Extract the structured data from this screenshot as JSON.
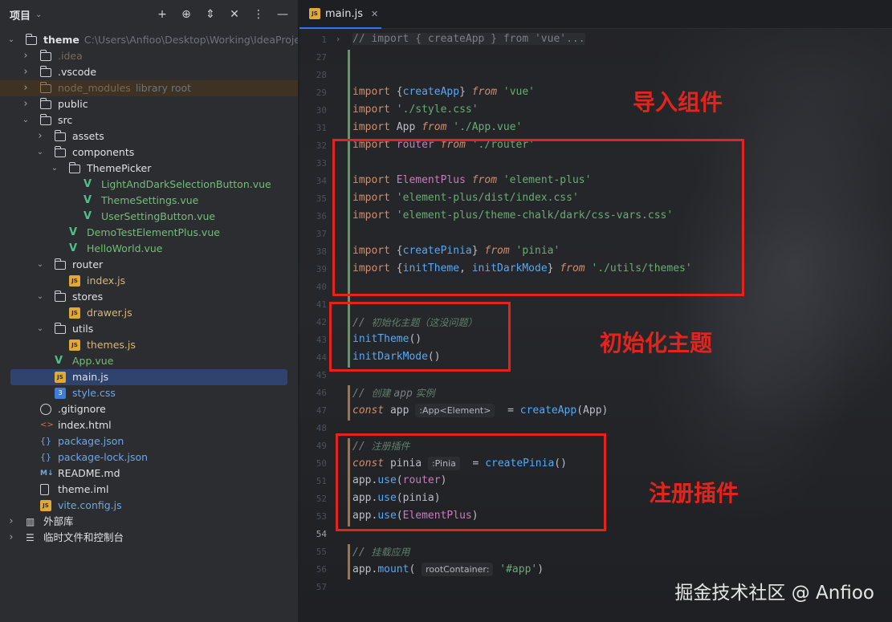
{
  "panel": {
    "title": "项目",
    "tools": [
      "add-icon",
      "locate-icon",
      "expand-icon",
      "collapse-icon",
      "more-icon",
      "minimize-icon"
    ]
  },
  "tree": [
    {
      "depth": 0,
      "arrow": "open",
      "icon": "folder",
      "label": "theme",
      "path": "C:\\Users\\Anfioo\\Desktop\\Working\\IdeaProjects\\",
      "bold": true,
      "color": "normal"
    },
    {
      "depth": 1,
      "arrow": "closed",
      "icon": "folder",
      "label": ".idea",
      "color": "excluded"
    },
    {
      "depth": 1,
      "arrow": "closed",
      "icon": "folder",
      "label": ".vscode",
      "color": "normal"
    },
    {
      "depth": 1,
      "arrow": "closed",
      "icon": "folder-excl",
      "label": "node_modules",
      "tag": "library root",
      "color": "excluded",
      "libroot": true
    },
    {
      "depth": 1,
      "arrow": "closed",
      "icon": "folder",
      "label": "public",
      "color": "normal"
    },
    {
      "depth": 1,
      "arrow": "open",
      "icon": "folder",
      "label": "src",
      "color": "normal"
    },
    {
      "depth": 2,
      "arrow": "closed",
      "icon": "folder",
      "label": "assets",
      "color": "normal"
    },
    {
      "depth": 2,
      "arrow": "open",
      "icon": "folder",
      "label": "components",
      "color": "normal"
    },
    {
      "depth": 3,
      "arrow": "open",
      "icon": "folder",
      "label": "ThemePicker",
      "color": "normal"
    },
    {
      "depth": 4,
      "arrow": "",
      "icon": "vue",
      "label": "LightAndDarkSelectionButton.vue",
      "color": "green"
    },
    {
      "depth": 4,
      "arrow": "",
      "icon": "vue",
      "label": "ThemeSettings.vue",
      "color": "green"
    },
    {
      "depth": 4,
      "arrow": "",
      "icon": "vue",
      "label": "UserSettingButton.vue",
      "color": "green"
    },
    {
      "depth": 3,
      "arrow": "",
      "icon": "vue",
      "label": "DemoTestElementPlus.vue",
      "color": "green"
    },
    {
      "depth": 3,
      "arrow": "",
      "icon": "vue",
      "label": "HelloWorld.vue",
      "color": "green"
    },
    {
      "depth": 2,
      "arrow": "open",
      "icon": "folder",
      "label": "router",
      "color": "normal"
    },
    {
      "depth": 3,
      "arrow": "",
      "icon": "js",
      "label": "index.js",
      "color": "yellow"
    },
    {
      "depth": 2,
      "arrow": "open",
      "icon": "folder",
      "label": "stores",
      "color": "normal"
    },
    {
      "depth": 3,
      "arrow": "",
      "icon": "js",
      "label": "drawer.js",
      "color": "yellow"
    },
    {
      "depth": 2,
      "arrow": "open",
      "icon": "folder",
      "label": "utils",
      "color": "normal"
    },
    {
      "depth": 3,
      "arrow": "",
      "icon": "js",
      "label": "themes.js",
      "color": "yellow"
    },
    {
      "depth": 2,
      "arrow": "",
      "icon": "vue",
      "label": "App.vue",
      "color": "green"
    },
    {
      "depth": 2,
      "arrow": "",
      "icon": "js",
      "label": "main.js",
      "color": "normal",
      "selected": true
    },
    {
      "depth": 2,
      "arrow": "",
      "icon": "css",
      "label": "style.css",
      "color": "blue"
    },
    {
      "depth": 1,
      "arrow": "",
      "icon": "git",
      "label": ".gitignore",
      "color": "normal"
    },
    {
      "depth": 1,
      "arrow": "",
      "icon": "html",
      "label": "index.html",
      "color": "normal"
    },
    {
      "depth": 1,
      "arrow": "",
      "icon": "json",
      "label": "package.json",
      "color": "blue"
    },
    {
      "depth": 1,
      "arrow": "",
      "icon": "json",
      "label": "package-lock.json",
      "color": "blue"
    },
    {
      "depth": 1,
      "arrow": "",
      "icon": "md",
      "label": "README.md",
      "color": "normal"
    },
    {
      "depth": 1,
      "arrow": "",
      "icon": "file",
      "label": "theme.iml",
      "color": "normal"
    },
    {
      "depth": 1,
      "arrow": "",
      "icon": "js",
      "label": "vite.config.js",
      "color": "blue"
    },
    {
      "depth": 0,
      "arrow": "closed",
      "icon": "lib",
      "label": "外部库",
      "color": "normal"
    },
    {
      "depth": 0,
      "arrow": "closed",
      "icon": "scratch",
      "label": "临时文件和控制台",
      "color": "normal"
    }
  ],
  "editor": {
    "tab_label": "main.js",
    "lines": [
      {
        "n": "1",
        "parts": [
          [
            "folded",
            "// import { createApp } from 'vue'..."
          ]
        ],
        "fold": true
      },
      {
        "n": "27",
        "parts": []
      },
      {
        "n": "28",
        "parts": []
      },
      {
        "n": "29",
        "parts": [
          [
            "kw-imp",
            "import"
          ],
          [
            "",
            " {"
          ],
          [
            "fn",
            "createApp"
          ],
          [
            "",
            "} "
          ],
          [
            "kw",
            "from"
          ],
          [
            "",
            " "
          ],
          [
            "str",
            "'vue'"
          ]
        ]
      },
      {
        "n": "30",
        "parts": [
          [
            "kw-imp",
            "import"
          ],
          [
            "",
            " "
          ],
          [
            "str",
            "'./style.css'"
          ]
        ]
      },
      {
        "n": "31",
        "parts": [
          [
            "kw-imp",
            "import"
          ],
          [
            "",
            " App "
          ],
          [
            "kw",
            "from"
          ],
          [
            "",
            " "
          ],
          [
            "str",
            "'./App.vue'"
          ]
        ]
      },
      {
        "n": "32",
        "parts": [
          [
            "kw-imp",
            "import"
          ],
          [
            "",
            " "
          ],
          [
            "var",
            "router"
          ],
          [
            "",
            " "
          ],
          [
            "kw",
            "from"
          ],
          [
            "",
            " "
          ],
          [
            "str",
            "'./router'"
          ]
        ]
      },
      {
        "n": "33",
        "parts": []
      },
      {
        "n": "34",
        "parts": [
          [
            "kw-imp",
            "import"
          ],
          [
            "",
            " "
          ],
          [
            "var",
            "ElementPlus"
          ],
          [
            "",
            " "
          ],
          [
            "kw",
            "from"
          ],
          [
            "",
            " "
          ],
          [
            "str",
            "'element-plus'"
          ]
        ]
      },
      {
        "n": "35",
        "parts": [
          [
            "kw-imp",
            "import"
          ],
          [
            "",
            " "
          ],
          [
            "str",
            "'element-plus/dist/index.css'"
          ]
        ]
      },
      {
        "n": "36",
        "parts": [
          [
            "kw-imp",
            "import"
          ],
          [
            "",
            " "
          ],
          [
            "str",
            "'element-plus/theme-chalk/dark/css-vars.css'"
          ]
        ]
      },
      {
        "n": "37",
        "parts": []
      },
      {
        "n": "38",
        "parts": [
          [
            "kw-imp",
            "import"
          ],
          [
            "",
            " {"
          ],
          [
            "fn",
            "createPinia"
          ],
          [
            "",
            "} "
          ],
          [
            "kw",
            "from"
          ],
          [
            "",
            " "
          ],
          [
            "str",
            "'pinia'"
          ]
        ]
      },
      {
        "n": "39",
        "parts": [
          [
            "kw-imp",
            "import"
          ],
          [
            "",
            " {"
          ],
          [
            "fn",
            "initTheme"
          ],
          [
            "",
            ", "
          ],
          [
            "fn",
            "initDarkMode"
          ],
          [
            "",
            "} "
          ],
          [
            "kw",
            "from"
          ],
          [
            "",
            " "
          ],
          [
            "str",
            "'./utils/themes'"
          ]
        ]
      },
      {
        "n": "40",
        "parts": []
      },
      {
        "n": "41",
        "parts": []
      },
      {
        "n": "42",
        "parts": [
          [
            "cmt",
            "// "
          ],
          [
            "cmt-zh",
            "初始化主题（这没问题）"
          ]
        ]
      },
      {
        "n": "43",
        "parts": [
          [
            "fn",
            "initTheme"
          ],
          [
            "",
            "()"
          ]
        ]
      },
      {
        "n": "44",
        "parts": [
          [
            "fn",
            "initDarkMode"
          ],
          [
            "",
            "()"
          ]
        ]
      },
      {
        "n": "45",
        "parts": []
      },
      {
        "n": "46",
        "parts": [
          [
            "cmt",
            "// "
          ],
          [
            "cmt-zh",
            "创建 "
          ],
          [
            "cmt",
            "app"
          ],
          [
            "cmt-zh",
            " 实例"
          ]
        ]
      },
      {
        "n": "47",
        "parts": [
          [
            "kw",
            "const"
          ],
          [
            "",
            " app "
          ],
          [
            "hint",
            ":App<Element>"
          ],
          [
            "",
            "  = "
          ],
          [
            "fn",
            "createApp"
          ],
          [
            "",
            "(App)"
          ]
        ]
      },
      {
        "n": "48",
        "parts": []
      },
      {
        "n": "49",
        "parts": [
          [
            "cmt",
            "// "
          ],
          [
            "cmt-zh",
            "注册插件"
          ]
        ]
      },
      {
        "n": "50",
        "parts": [
          [
            "kw",
            "const"
          ],
          [
            "",
            " pinia "
          ],
          [
            "hint",
            ":Pinia"
          ],
          [
            "",
            "  = "
          ],
          [
            "fn",
            "createPinia"
          ],
          [
            "",
            "()"
          ]
        ]
      },
      {
        "n": "51",
        "parts": [
          [
            "",
            "app."
          ],
          [
            "fn",
            "use"
          ],
          [
            "",
            "("
          ],
          [
            "var",
            "router"
          ],
          [
            "",
            ")"
          ]
        ]
      },
      {
        "n": "52",
        "parts": [
          [
            "",
            "app."
          ],
          [
            "fn",
            "use"
          ],
          [
            "",
            "(pinia)"
          ]
        ]
      },
      {
        "n": "53",
        "parts": [
          [
            "",
            "app."
          ],
          [
            "fn",
            "use"
          ],
          [
            "",
            "("
          ],
          [
            "var",
            "ElementPlus"
          ],
          [
            "",
            ")"
          ]
        ]
      },
      {
        "n": "54",
        "parts": [],
        "active": true
      },
      {
        "n": "55",
        "parts": [
          [
            "cmt",
            "// "
          ],
          [
            "cmt-zh",
            "挂载应用"
          ]
        ]
      },
      {
        "n": "56",
        "parts": [
          [
            "",
            "app."
          ],
          [
            "fn",
            "mount"
          ],
          [
            "",
            "( "
          ],
          [
            "hint",
            "rootContainer:"
          ],
          [
            "",
            " "
          ],
          [
            "str",
            "'#app'"
          ],
          [
            "",
            ")"
          ]
        ]
      },
      {
        "n": "57",
        "parts": []
      }
    ]
  },
  "annotations": {
    "imports": "导入组件",
    "init_theme": "初始化主题",
    "plugins": "注册插件"
  },
  "watermark": "掘金技术社区 @ Anfioo",
  "colors": {
    "accent": "#3574f0",
    "highlight_box": "#e4241c",
    "vcs_added": "#5d9c5f",
    "vcs_modified": "#a4724a"
  }
}
